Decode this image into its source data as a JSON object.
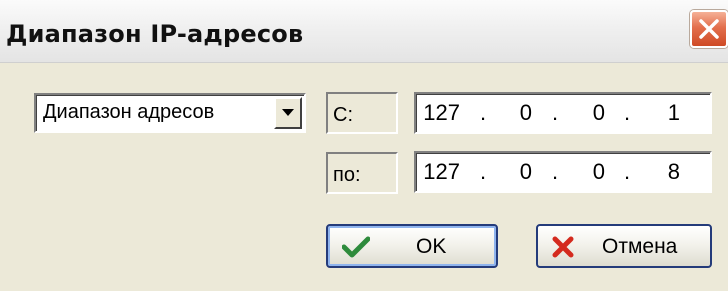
{
  "window": {
    "title": "Диапазон IP-адресов"
  },
  "range_type": {
    "selected": "Диапазон адресов"
  },
  "from": {
    "label": "С:",
    "octets": [
      "127",
      "0",
      "0",
      "1"
    ]
  },
  "to": {
    "label": "по:",
    "octets": [
      "127",
      "0",
      "0",
      "8"
    ]
  },
  "buttons": {
    "ok_label": "OK",
    "cancel_label": "Отмена"
  },
  "icons": {
    "close": "close-icon",
    "dropdown": "chevron-down-icon",
    "ok": "checkmark-icon",
    "cancel": "cross-icon"
  },
  "colors": {
    "dialog_bg": "#ece9d8",
    "close_button": "#e36f4d",
    "ok_check": "#2e8b3c",
    "cancel_cross": "#d42a1e",
    "button_border": "#243b7a"
  }
}
